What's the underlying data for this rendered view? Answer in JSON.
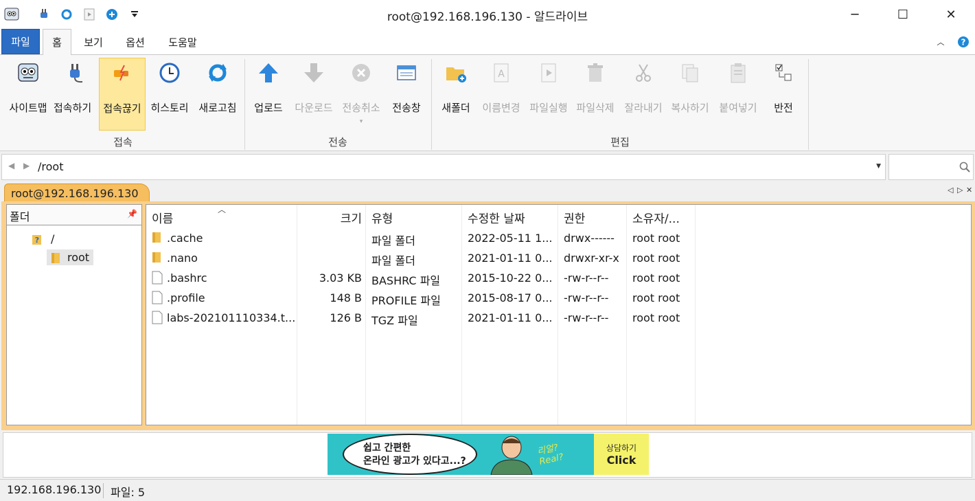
{
  "window": {
    "title": "root@192.168.196.130 - 알드라이브"
  },
  "quick_access": [
    "app-logo-icon",
    "connect-icon",
    "refresh-icon",
    "run-icon",
    "add-icon",
    "customize-icon"
  ],
  "menu_tabs": {
    "file": "파일",
    "home": "홈",
    "view": "보기",
    "options": "옵션",
    "help": "도움말"
  },
  "ribbon": {
    "buttons": {
      "sitemap": "사이트맵",
      "connect": "접속하기",
      "disconnect": "접속끊기",
      "history": "히스토리",
      "refresh": "새로고침",
      "upload": "업로드",
      "download": "다운로드",
      "cancel": "전송취소",
      "transfer_window": "전송창",
      "new_folder": "새폴더",
      "rename": "이름변경",
      "execute": "파일실행",
      "delete": "파일삭제",
      "cut": "잘라내기",
      "copy": "복사하기",
      "paste": "붙여넣기",
      "invert": "반전"
    },
    "groups": {
      "connection": "접속",
      "transfer": "전송",
      "edit": "편집"
    }
  },
  "address": {
    "path": "/root"
  },
  "session_tab": {
    "label": "root@192.168.196.130"
  },
  "folder_pane": {
    "header": "폴더",
    "nodes": [
      {
        "label": "/"
      },
      {
        "label": "root"
      }
    ]
  },
  "file_list": {
    "columns": {
      "name": "이름",
      "size": "크기",
      "type": "유형",
      "modified": "수정한 날짜",
      "perm": "권한",
      "owner": "소유자/..."
    },
    "rows": [
      {
        "name": ".cache",
        "size": "",
        "type": "파일 폴더",
        "modified": "2022-05-11 1...",
        "perm": "drwx------",
        "owner": "root root",
        "icon": "folder-icon"
      },
      {
        "name": ".nano",
        "size": "",
        "type": "파일 폴더",
        "modified": "2021-01-11 0...",
        "perm": "drwxr-xr-x",
        "owner": "root root",
        "icon": "folder-icon"
      },
      {
        "name": ".bashrc",
        "size": "3.03 KB",
        "type": "BASHRC 파일",
        "modified": "2015-10-22 0...",
        "perm": "-rw-r--r--",
        "owner": "root root",
        "icon": "file-icon"
      },
      {
        "name": ".profile",
        "size": "148 B",
        "type": "PROFILE 파일",
        "modified": "2015-08-17 0...",
        "perm": "-rw-r--r--",
        "owner": "root root",
        "icon": "file-icon"
      },
      {
        "name": "labs-202101110334.t...",
        "size": "126 B",
        "type": "TGZ 파일",
        "modified": "2021-01-11 0...",
        "perm": "-rw-r--r--",
        "owner": "root root",
        "icon": "file-icon"
      }
    ]
  },
  "ad": {
    "line1": "쉽고 간편한",
    "line2": "온라인 광고가 있다고...?",
    "cta_top": "상담하기",
    "cta": "Click",
    "sticker": "리얼? Real?"
  },
  "status": {
    "host": "192.168.196.130",
    "files": "파일: 5"
  },
  "colors": {
    "accent": "#2b6cc4",
    "session_tab": "#f6be5f",
    "highlight": "#fde89c"
  }
}
